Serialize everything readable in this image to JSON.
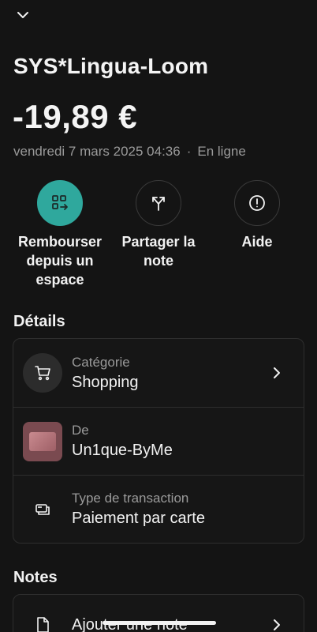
{
  "header": {
    "back_icon": "chevron-down-icon"
  },
  "transaction": {
    "merchant": "SYS*Lingua-Loom",
    "amount": "-19,89 €",
    "date": "vendredi 7 mars 2025 04:36",
    "separator": "·",
    "channel": "En ligne"
  },
  "actions": [
    {
      "label": "Rembourser depuis un espace",
      "icon": "qr-transfer-icon",
      "accent": "#2fa89d"
    },
    {
      "label": "Partager la note",
      "icon": "split-arrows-icon"
    },
    {
      "label": "Aide",
      "icon": "info-circle-icon"
    }
  ],
  "details": {
    "title": "Détails",
    "rows": [
      {
        "label": "Catégorie",
        "value": "Shopping",
        "icon": "shopping-cart-icon"
      },
      {
        "label": "De",
        "value": "Un1que-ByMe",
        "icon": "card-thumbnail-icon"
      },
      {
        "label": "Type de transaction",
        "value": "Paiement par carte",
        "icon": "card-payment-icon"
      }
    ]
  },
  "notes": {
    "title": "Notes",
    "add_label": "Ajouter une note",
    "icon": "document-icon"
  }
}
